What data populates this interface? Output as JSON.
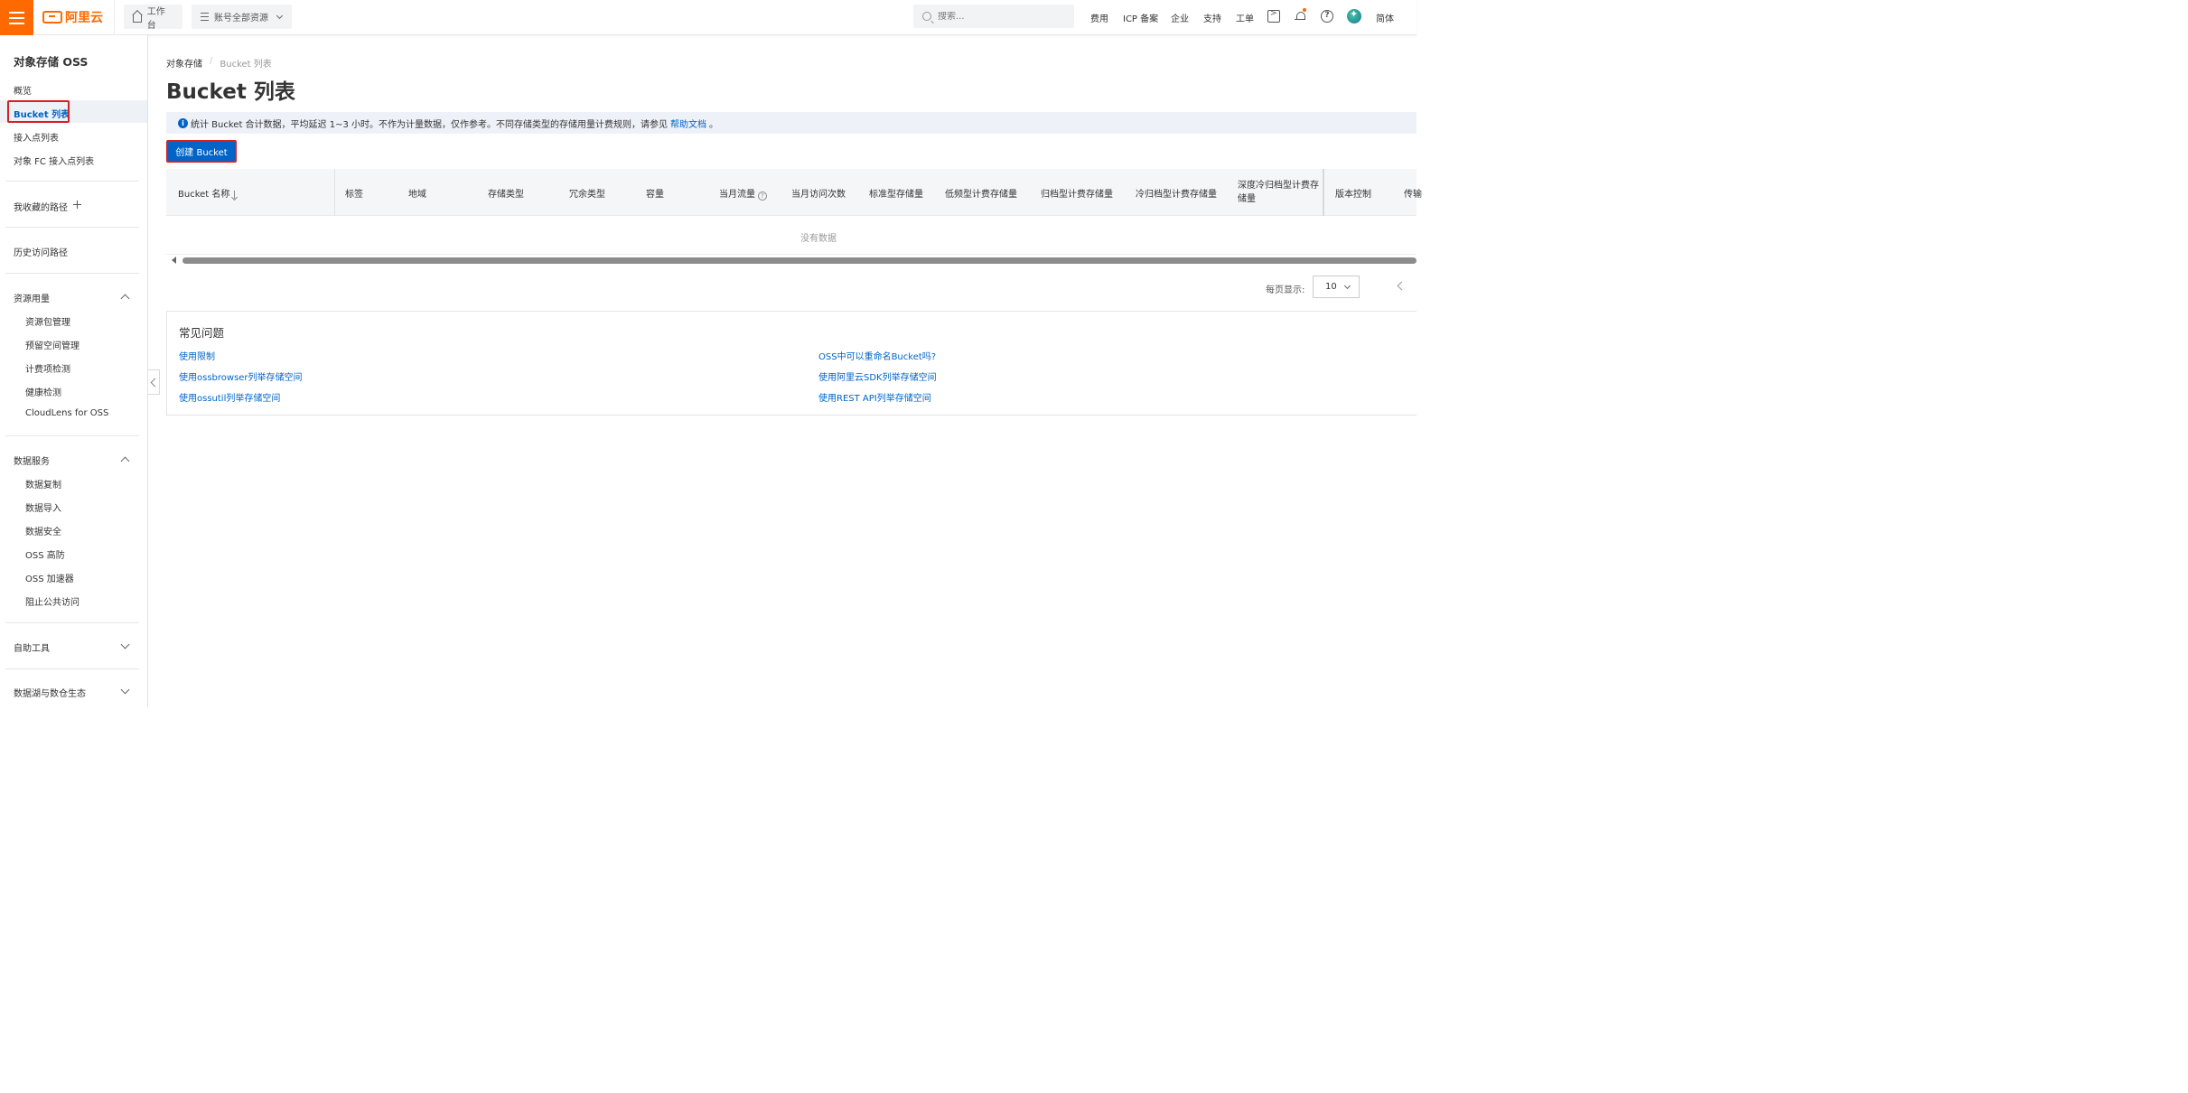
{
  "topbar": {
    "brand": "阿里云",
    "workbench": "工作台",
    "resources": "账号全部资源",
    "search_placeholder": "搜索...",
    "links": [
      "费用",
      "ICP 备案",
      "企业",
      "支持",
      "工单"
    ],
    "lang": "简体",
    "accent_color": "#ff6a00"
  },
  "sidebar": {
    "title": "对象存储 OSS",
    "overview": "概览",
    "bucket_list": "Bucket 列表",
    "access_points": "接入点列表",
    "fc_access_points": "对象 FC 接入点列表",
    "favorites": "我收藏的路径",
    "history": "历史访问路径",
    "resource_usage": "资源用量",
    "resource_items": [
      "资源包管理",
      "预留空间管理",
      "计费项检测",
      "健康检测",
      "CloudLens for OSS"
    ],
    "data_services": "数据服务",
    "data_items": [
      "数据复制",
      "数据导入",
      "数据安全",
      "OSS 高防",
      "OSS 加速器",
      "阻止公共访问"
    ],
    "self_tools": "自助工具",
    "data_lake": "数据湖与数仓生态"
  },
  "main": {
    "breadcrumb": [
      "对象存储",
      "Bucket 列表"
    ],
    "title": "Bucket 列表",
    "notice_text": "统计 Bucket 合计数据，平均延迟 1~3 小时。不作为计量数据，仅作参考。不同存储类型的存储用量计费规则，请参见",
    "notice_link": "帮助文档",
    "notice_end": "。",
    "create_button": "创建 Bucket",
    "columns": [
      "Bucket 名称",
      "标签",
      "地域",
      "存储类型",
      "冗余类型",
      "容量",
      "当月流量",
      "当月访问次数",
      "标准型存储量",
      "低频型计费存储量",
      "归档型计费存储量",
      "冷归档型计费存储量",
      "深度冷归档型计费存储量",
      "版本控制",
      "传输"
    ],
    "empty_text": "没有数据",
    "page_size_label": "每页显示:",
    "page_size": "10",
    "link_color": "#0064c8"
  },
  "faq": {
    "title": "常见问题",
    "left": [
      "使用限制",
      "使用ossbrowser列举存储空间",
      "使用ossutil列举存储空间"
    ],
    "right": [
      "OSS中可以重命名Bucket吗?",
      "使用阿里云SDK列举存储空间",
      "使用REST API列举存储空间"
    ]
  }
}
